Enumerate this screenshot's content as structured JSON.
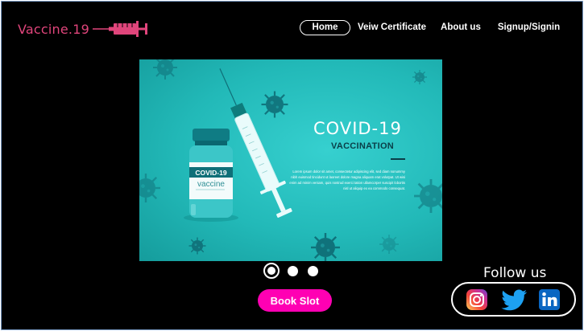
{
  "brand": {
    "name": "Vaccine.19",
    "icon": "syringe-icon",
    "color": "#e0457b"
  },
  "nav": {
    "items": [
      {
        "label": "Home",
        "active": true
      },
      {
        "label": "Veiw Certificate",
        "active": false
      },
      {
        "label": "About us",
        "active": false
      },
      {
        "label": "Signup/Signin",
        "active": false
      }
    ]
  },
  "hero": {
    "vial_label": "COVID-19",
    "vial_sub": "vaccine",
    "title": "COVID-19",
    "subtitle": "VACCINATION",
    "body": "Lorem ipsum dolor sit amet, consectetur adipiscing elit, sed diam nonummy nibh euismod tincidunt ut laoreet dolore magna aliquam erat volutpat. Ut wisi enim ad minim veniam, quis nostrud exerci tation ullamcorper suscipit lobortis nisl ut aliquip ex ea commodo consequat.",
    "background": "#22b9b8"
  },
  "carousel": {
    "slides": 3,
    "active_index": 0
  },
  "actions": {
    "book_label": "Book Slot",
    "book_color": "#ff00b3"
  },
  "social": {
    "heading": "Follow us",
    "links": [
      {
        "name": "instagram-icon"
      },
      {
        "name": "twitter-icon"
      },
      {
        "name": "linkedin-icon"
      }
    ]
  }
}
